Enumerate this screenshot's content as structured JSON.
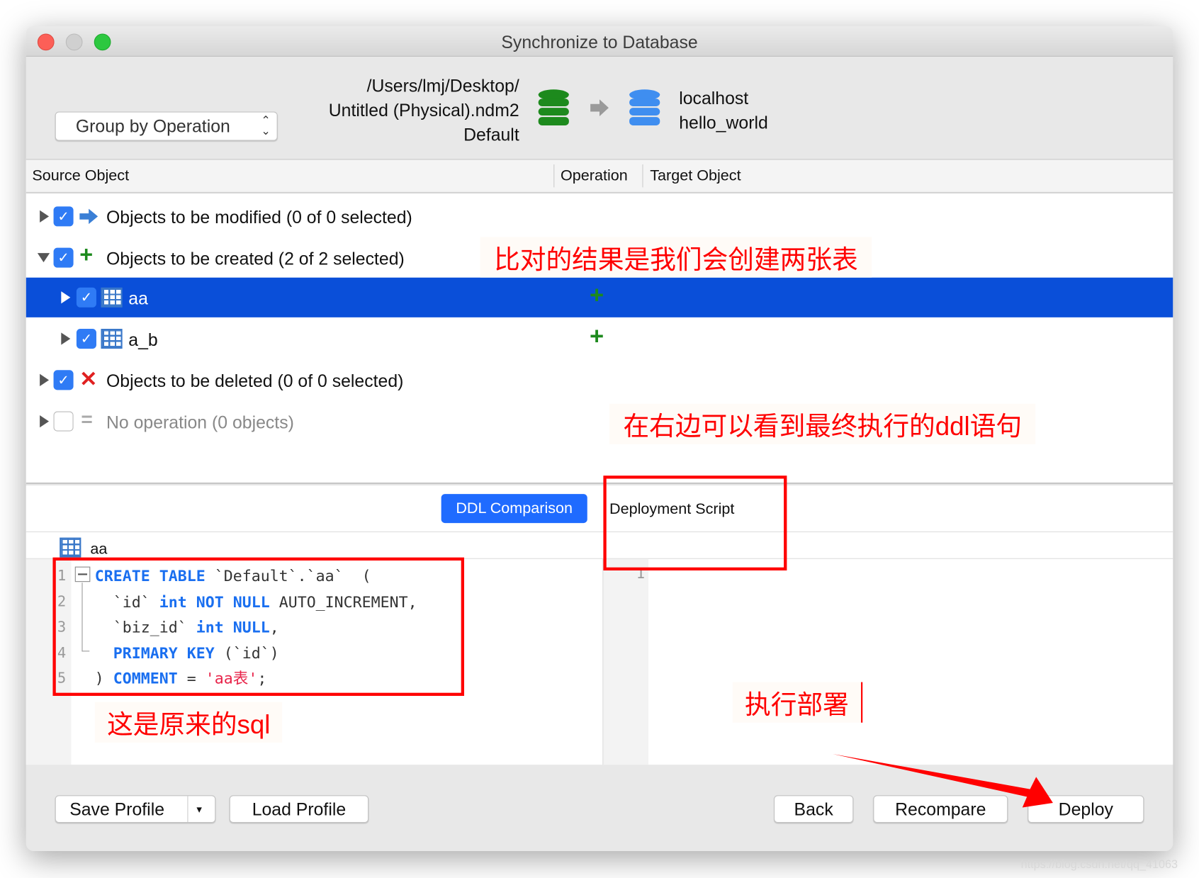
{
  "window": {
    "title": "Synchronize to Database"
  },
  "toolbar": {
    "group_select": "Group by Operation",
    "source_path": "/Users/lmj/Desktop/",
    "source_file": "Untitled (Physical).ndm2",
    "source_schema": "Default",
    "target_host": "localhost",
    "target_db": "hello_world"
  },
  "columns": [
    "Source Object",
    "Operation",
    "Target Object"
  ],
  "rows": [
    {
      "label": "Objects to be modified (0 of 0 selected)",
      "checked": true,
      "icon": "arrow-right-icon"
    },
    {
      "label": "Objects to be created (2 of 2 selected)",
      "checked": true,
      "icon": "plus-icon"
    },
    {
      "label": "aa",
      "checked": true,
      "icon": "table-icon",
      "op": "+",
      "selected": true
    },
    {
      "label": "a_b",
      "checked": true,
      "icon": "table-icon",
      "op": "+"
    },
    {
      "label": "Objects to be deleted (0 of 0 selected)",
      "checked": true,
      "icon": "x-icon"
    },
    {
      "label": "No operation (0 objects)",
      "checked": false,
      "icon": "equals-icon"
    }
  ],
  "tabs": {
    "ddl": "DDL Comparison",
    "script": "Deployment Script"
  },
  "ddl": {
    "object": "aa",
    "lines": [
      "1",
      "2",
      "3",
      "4",
      "5"
    ],
    "right_line": "1",
    "l1a": "CREATE TABLE",
    "l1b": " `Default`.`aa`  (",
    "l2a": "`id` ",
    "l2b": "int NOT NULL",
    "l2c": " AUTO_INCREMENT,",
    "l3a": "`biz_id` ",
    "l3b": "int NULL",
    "l3c": ",",
    "l4a": "PRIMARY KEY",
    "l4b": " (`id`)",
    "l5a": ") ",
    "l5b": "COMMENT",
    "l5c": " = ",
    "l5d": "'aa表'",
    "l5e": ";"
  },
  "footer": {
    "save": "Save Profile",
    "save_menu": "▾",
    "load": "Load Profile",
    "back": "Back",
    "recompare": "Recompare",
    "deploy": "Deploy"
  },
  "annotations": {
    "a1": "比对的结果是我们会创建两张表",
    "a2": "在右边可以看到最终执行的ddl语句",
    "a3": "这是原来的sql",
    "a4": "执行部署"
  },
  "watermark": "https://blog.csdn.net/qq_41063",
  "colors": {
    "selection": "#0a4fd9",
    "accent": "#1f6bff",
    "annotation": "#ff0000"
  }
}
